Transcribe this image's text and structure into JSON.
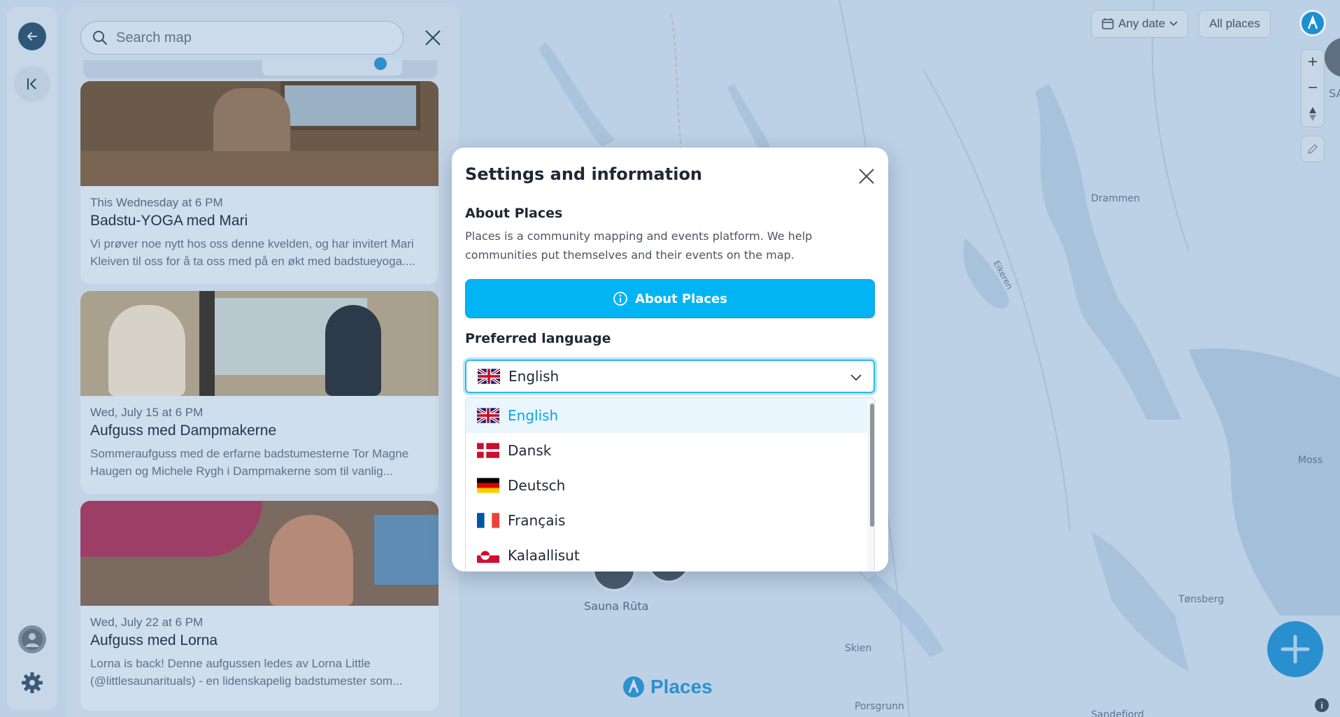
{
  "map": {
    "labels": [
      "Drammen",
      "Eikeren",
      "Moss",
      "Tønsberg",
      "Skien",
      "Porsgrunn",
      "Sandefjord",
      "Sauna Rūta",
      "SA"
    ],
    "brand_text": "Places"
  },
  "top_controls": {
    "date_filter": "Any date",
    "places_filter": "All places",
    "zoom_in": "+",
    "zoom_out": "−",
    "info": "i"
  },
  "panel": {
    "search_placeholder": "Search map",
    "cards": [
      {
        "date": "This Wednesday at 6 PM",
        "title": "Badstu-YOGA med Mari",
        "desc": "Vi prøver noe nytt hos oss denne kvelden, og har invitert Mari Kleiven til oss for å ta oss med på en økt med badstueyoga...."
      },
      {
        "date": "Wed, July 15 at 6 PM",
        "title": "Aufguss med Dampmakerne",
        "desc": "Sommeraufguss med de erfarne badstumesterne Tor Magne Haugen og Michele Rygh i Dampmakerne som til vanlig..."
      },
      {
        "date": "Wed, July 22 at 6 PM",
        "title": "Aufguss med Lorna",
        "desc": "Lorna is back! Denne aufgussen ledes av Lorna Little (@littlesaunarituals) - en lidenskapelig badstumester som..."
      }
    ]
  },
  "modal": {
    "title": "Settings and information",
    "about_heading": "About Places",
    "about_text": "Places is a community mapping and events platform. We help communities put themselves and their events on the map.",
    "about_button": "About Places",
    "language_heading": "Preferred language",
    "selected_language": "English",
    "languages": [
      {
        "label": "English",
        "flag": "uk-flag-icon",
        "active": true
      },
      {
        "label": "Dansk",
        "flag": "denmark-flag-icon",
        "active": false
      },
      {
        "label": "Deutsch",
        "flag": "germany-flag-icon",
        "active": false
      },
      {
        "label": "Français",
        "flag": "france-flag-icon",
        "active": false
      },
      {
        "label": "Kalaallisut",
        "flag": "greenland-flag-icon",
        "active": false
      }
    ]
  },
  "colors": {
    "accent": "#03b4f5",
    "accent_text": "#0aa6e6",
    "overlay_map": "#b8cee3"
  }
}
